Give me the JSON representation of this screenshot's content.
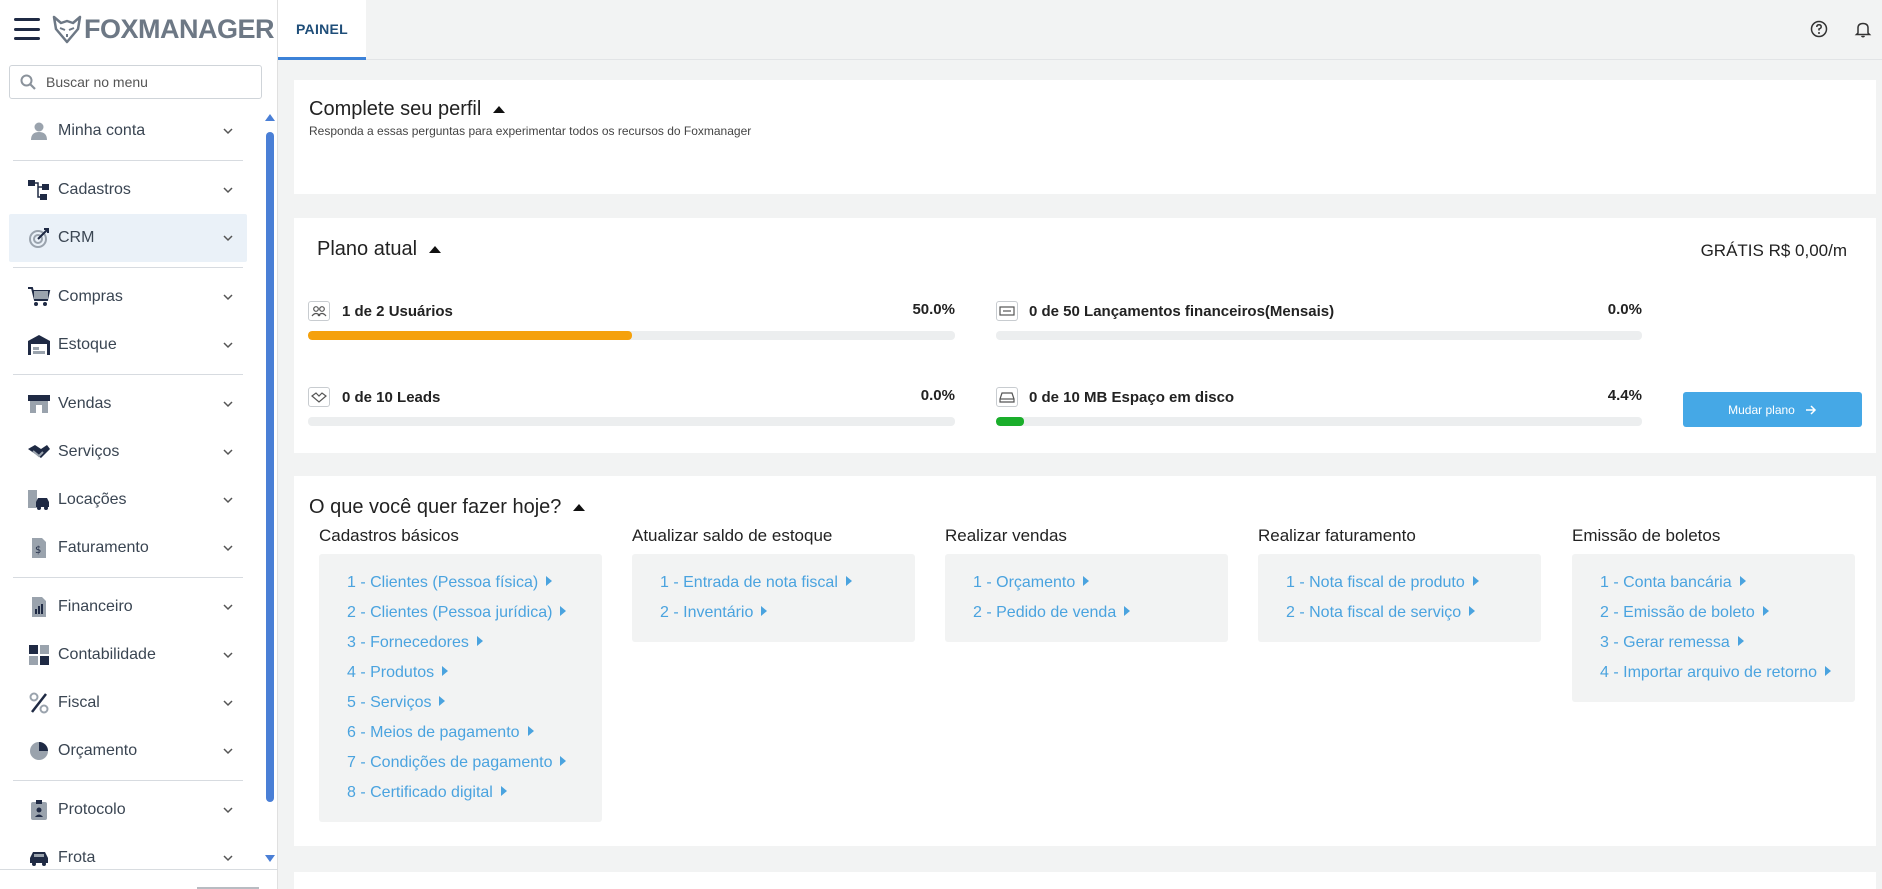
{
  "brand": {
    "name": "FOXMANAGER"
  },
  "search": {
    "placeholder": "Buscar no menu"
  },
  "menu": [
    {
      "label": "Minha conta",
      "icon": "user-icon"
    },
    {
      "label": "Cadastros",
      "icon": "hierarchy-icon"
    },
    {
      "label": "CRM",
      "icon": "target-icon"
    },
    {
      "label": "Compras",
      "icon": "cart-icon"
    },
    {
      "label": "Estoque",
      "icon": "warehouse-icon"
    },
    {
      "label": "Vendas",
      "icon": "store-icon"
    },
    {
      "label": "Serviços",
      "icon": "handshake-icon"
    },
    {
      "label": "Locações",
      "icon": "car-building-icon"
    },
    {
      "label": "Faturamento",
      "icon": "invoice-icon"
    },
    {
      "label": "Financeiro",
      "icon": "finance-chart-icon"
    },
    {
      "label": "Contabilidade",
      "icon": "calculator-icon"
    },
    {
      "label": "Fiscal",
      "icon": "percent-icon"
    },
    {
      "label": "Orçamento",
      "icon": "pie-chart-icon"
    },
    {
      "label": "Protocolo",
      "icon": "badge-icon"
    },
    {
      "label": "Frota",
      "icon": "car-icon"
    }
  ],
  "topbar": {
    "tab_label": "PAINEL"
  },
  "profile": {
    "title": "Complete seu perfil",
    "subtitle": "Responda a essas perguntas para experimentar todos os recursos do Foxmanager"
  },
  "plan": {
    "title": "Plano atual",
    "price": "GRÁTIS R$ 0,00/m",
    "stats": [
      {
        "label": "1 de 2 Usuários",
        "pct": "50.0%",
        "value": 0.5,
        "color": "#f5a10c",
        "icon": "users-icon"
      },
      {
        "label": "0 de 50 Lançamentos financeiros(Mensais)",
        "pct": "0.0%",
        "value": 0.0,
        "color": "#f5a10c",
        "icon": "money-icon"
      },
      {
        "label": "0 de 10 Leads",
        "pct": "0.0%",
        "value": 0.0,
        "color": "#f5a10c",
        "icon": "handshake-icon"
      },
      {
        "label": "0 de 10 MB Espaço em disco",
        "pct": "4.4%",
        "value": 0.044,
        "color": "#1aae2b",
        "icon": "disk-icon"
      }
    ],
    "button_label": "Mudar plano"
  },
  "todo": {
    "title": "O que você quer fazer hoje?",
    "columns": [
      {
        "title": "Cadastros básicos",
        "links": [
          "1 - Clientes (Pessoa física)",
          "2 - Clientes (Pessoa jurídica)",
          "3 - Fornecedores",
          "4 - Produtos",
          "5 - Serviços",
          "6 - Meios de pagamento",
          "7 - Condições de pagamento",
          "8 - Certificado digital"
        ]
      },
      {
        "title": "Atualizar saldo de estoque",
        "links": [
          "1 - Entrada de nota fiscal",
          "2 - Inventário"
        ]
      },
      {
        "title": "Realizar vendas",
        "links": [
          "1 - Orçamento",
          "2 - Pedido de venda"
        ]
      },
      {
        "title": "Realizar faturamento",
        "links": [
          "1 - Nota fiscal de produto",
          "2 - Nota fiscal de serviço"
        ]
      },
      {
        "title": "Emissão de boletos",
        "links": [
          "1 - Conta bancária",
          "2 - Emissão de boleto",
          "3 - Gerar remessa",
          "4 - Importar arquivo de retorno"
        ]
      }
    ]
  },
  "colors": {
    "accent": "#3c82d8",
    "link": "#4aa3df",
    "button": "#45a8e6",
    "scrollbar": "#4a7fd6"
  }
}
